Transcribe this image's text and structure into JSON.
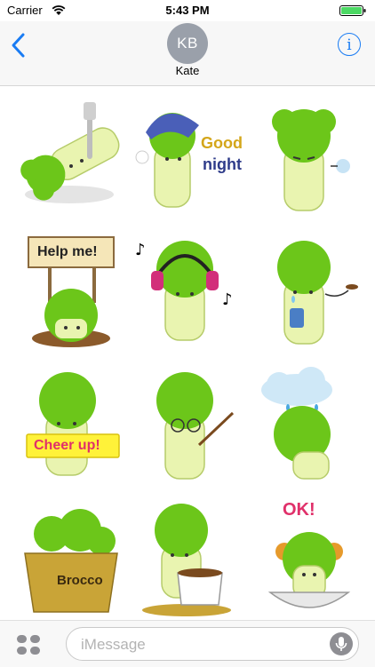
{
  "status": {
    "carrier": "Carrier",
    "time": "5:43 PM"
  },
  "header": {
    "avatar_initials": "KB",
    "contact_name": "Kate",
    "info_glyph": "i"
  },
  "stickers": [
    {
      "name": "broccoli-fork",
      "text": ""
    },
    {
      "name": "broccoli-good-night",
      "text_line1": "Good",
      "text_line2": "night"
    },
    {
      "name": "broccoli-angry",
      "text": ""
    },
    {
      "name": "broccoli-help-me",
      "text": "Help me!"
    },
    {
      "name": "broccoli-music",
      "text": ""
    },
    {
      "name": "broccoli-crying",
      "text": ""
    },
    {
      "name": "broccoli-cheer-up",
      "text": "Cheer up!"
    },
    {
      "name": "broccoli-teacher",
      "text": ""
    },
    {
      "name": "broccoli-rain-cloud",
      "text": ""
    },
    {
      "name": "broccoli-basket",
      "text": "Brocco"
    },
    {
      "name": "broccoli-coffee",
      "text": ""
    },
    {
      "name": "broccoli-ok",
      "text": "OK!"
    }
  ],
  "input": {
    "placeholder": "iMessage"
  },
  "colors": {
    "accent": "#1a7cf3",
    "broccoli_green": "#6cc61a",
    "stem": "#e9f4b0"
  }
}
